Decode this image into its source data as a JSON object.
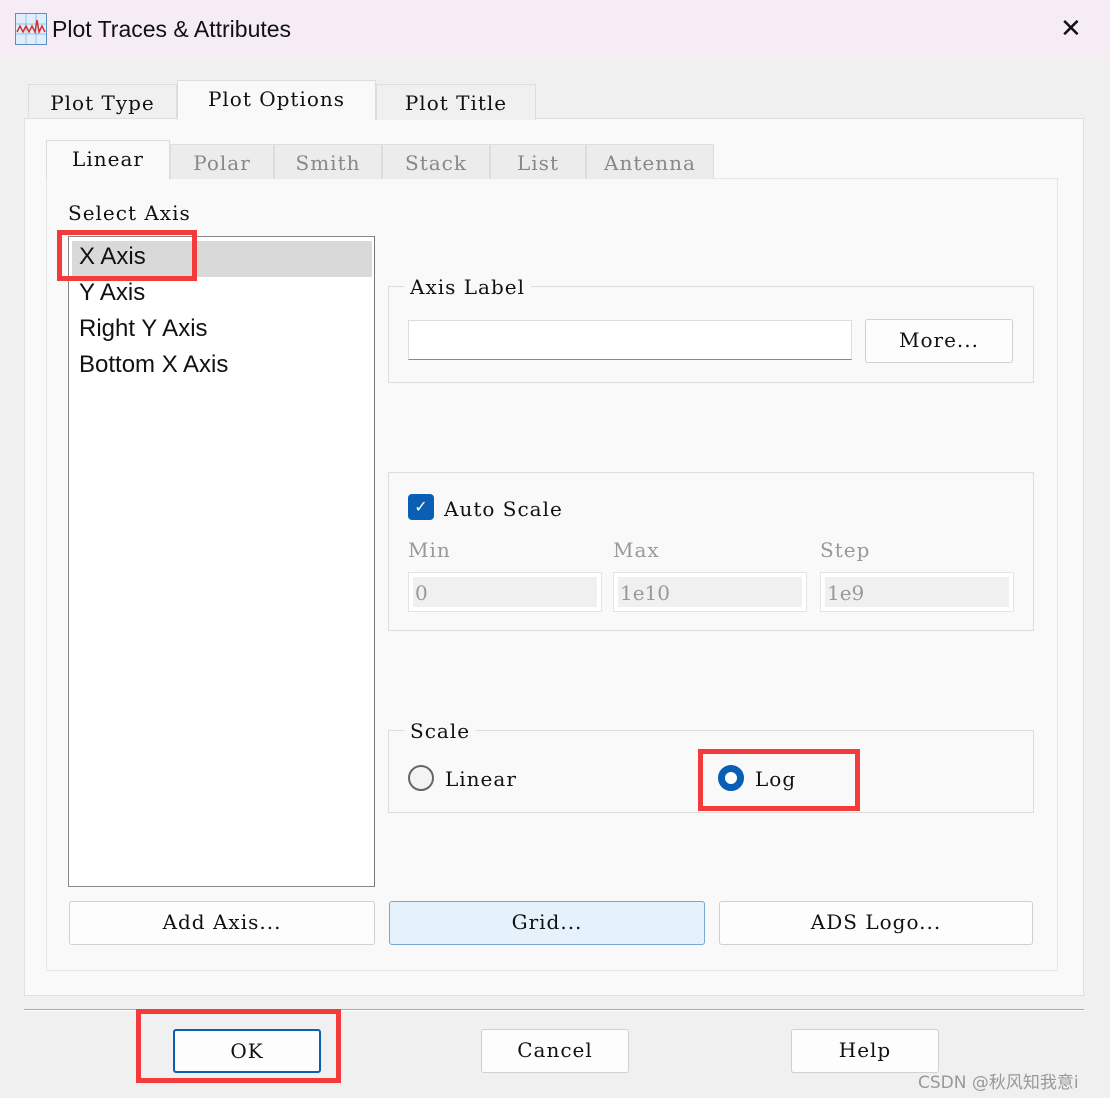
{
  "window": {
    "title": "Plot Traces & Attributes",
    "close_icon": "close-icon"
  },
  "outer_tabs": [
    {
      "label": "Plot Type"
    },
    {
      "label": "Plot Options",
      "active": true
    },
    {
      "label": "Plot Title"
    }
  ],
  "inner_tabs": [
    {
      "label": "Linear",
      "active": true
    },
    {
      "label": "Polar"
    },
    {
      "label": "Smith"
    },
    {
      "label": "Stack"
    },
    {
      "label": "List"
    },
    {
      "label": "Antenna"
    }
  ],
  "select_axis": {
    "label": "Select Axis",
    "items": [
      "X Axis",
      "Y Axis",
      "Right Y Axis",
      "Bottom X Axis"
    ],
    "selected": "X Axis"
  },
  "axis_label": {
    "legend": "Axis Label",
    "value": "",
    "more_button": "More..."
  },
  "auto_scale": {
    "label": "Auto Scale",
    "checked": true,
    "min_label": "Min",
    "max_label": "Max",
    "step_label": "Step",
    "min": "0",
    "max": "1e10",
    "step": "1e9"
  },
  "scale": {
    "legend": "Scale",
    "options": [
      "Linear",
      "Log"
    ],
    "selected": "Log"
  },
  "buttons": {
    "add_axis": "Add Axis...",
    "grid": "Grid...",
    "ads_logo": "ADS Logo...",
    "ok": "OK",
    "cancel": "Cancel",
    "help": "Help"
  },
  "colors": {
    "accent": "#0a5fb4",
    "highlight": "#f33b3b",
    "titlebar": "#f6ecf6"
  },
  "watermark": "CSDN @秋风知我意i"
}
